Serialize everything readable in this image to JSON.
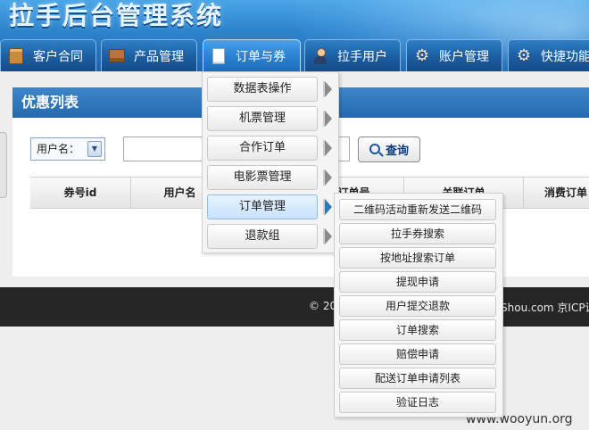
{
  "header": {
    "site_title": "拉手后台管理系统"
  },
  "nav": {
    "tabs": [
      {
        "label": "客户合同",
        "icon": "contract-icon"
      },
      {
        "label": "产品管理",
        "icon": "product-box-icon"
      },
      {
        "label": "订单与券",
        "icon": "document-icon",
        "active": true
      },
      {
        "label": "拉手用户",
        "icon": "user-icon"
      },
      {
        "label": "账户管理",
        "icon": "gear-icon"
      },
      {
        "label": "快捷功能",
        "icon": "gear-icon"
      }
    ]
  },
  "panel": {
    "title": "优惠列表"
  },
  "filter": {
    "user_select_label": "用户名：",
    "search_value": "",
    "query_button": "查询"
  },
  "table": {
    "headers": [
      "券号id",
      "用户名",
      "订单号",
      "关联订单",
      "消费订单"
    ]
  },
  "dropdown": {
    "items": [
      "数据表操作",
      "机票管理",
      "合作订单",
      "电影票管理",
      "订单管理",
      "退款组"
    ],
    "active_index": 4
  },
  "submenu": {
    "items": [
      "二维码活动重新发送二维码",
      "拉手券搜索",
      "按地址搜索订单",
      "提现申请",
      "用户提交退款",
      "订单搜索",
      "赔偿申请",
      "配送订单申请列表",
      "验证日志"
    ]
  },
  "footer": {
    "copyright": "© 20",
    "domain_fragment": "Shou.com  京ICP证"
  },
  "watermark": "www.wooyun.org",
  "colors": {
    "header_blue": "#2f86cf",
    "panel_title_blue": "#2569ab",
    "footer_dark": "#262626"
  }
}
